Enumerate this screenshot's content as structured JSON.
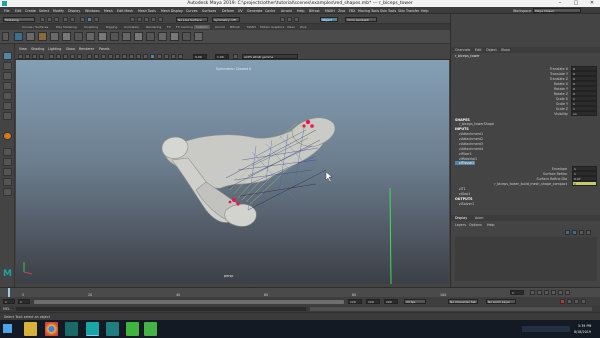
{
  "titlebar": {
    "title": "Autodesk Maya 2019: C:\\projects\\other\\tutorial\\scenes\\examples\\red_shapes.mb*   ---   r_biceps_tower"
  },
  "menubar": {
    "items": [
      "File",
      "Edit",
      "Create",
      "Select",
      "Modify",
      "Display",
      "Windows",
      "Mesh",
      "Edit Mesh",
      "Mesh Tools",
      "Mesh Display",
      "Curves",
      "Surfaces",
      "Deform",
      "UV",
      "Generate",
      "Cache",
      "Arnold",
      "Help",
      "Bifrost",
      "MASH",
      "Ziva",
      "FBX",
      "Moving Tools",
      "Skin Tools",
      "Skin Transfer",
      "Help"
    ],
    "workspace_label": "Workspace:",
    "workspace_value": "Maya Classic"
  },
  "statusline": {
    "mode": "Modeling",
    "no_live": "No Live Surface",
    "symmetry": "Symmetry: Off",
    "object_field": "Object",
    "user": "Chris Garibaldi"
  },
  "shelf": {
    "tabs": [
      "Curves / Surfaces",
      "Poly Modeling",
      "Sculpting",
      "Rigging",
      "Animation",
      "Rendering",
      "FX",
      "FX Caching",
      "Custom",
      "Arnold",
      "Bifrost",
      "MASH",
      "Motion Graphics",
      "XGen",
      "Ziva"
    ]
  },
  "viewport": {
    "menu": [
      "View",
      "Shading",
      "Lighting",
      "Show",
      "Renderer",
      "Panels"
    ],
    "hud_label": "Symmetric: Closest 0",
    "camera_label": "persp",
    "gamma_value": "0.00",
    "exposure_value": "1.00",
    "colorspace": "ACES sRGB gamma"
  },
  "channel_box": {
    "tabs": [
      "Channels",
      "Edit",
      "Object",
      "Show"
    ],
    "object_name": "r_biceps_tower",
    "attributes": [
      {
        "name": "Translate X",
        "value": "0"
      },
      {
        "name": "Translate Y",
        "value": "0"
      },
      {
        "name": "Translate Z",
        "value": "0"
      },
      {
        "name": "Rotate X",
        "value": "0"
      },
      {
        "name": "Rotate Y",
        "value": "0"
      },
      {
        "name": "Rotate Z",
        "value": "0"
      },
      {
        "name": "Scale X",
        "value": "1"
      },
      {
        "name": "Scale Y",
        "value": "1"
      },
      {
        "name": "Scale Z",
        "value": "1"
      },
      {
        "name": "Visibility",
        "value": "on"
      }
    ],
    "shapes_header": "SHAPES",
    "shape_name": "r_biceps_towerShape",
    "inputs_header": "INPUTS",
    "inputs": [
      "ziAttachment1",
      "ziAttachment2",
      "ziAttachment3",
      "ziAttachment4",
      "ziFiber1",
      "ziMaterial1",
      "ziTissue1"
    ],
    "tissue_attrs": [
      {
        "name": "Envelope",
        "value": "1"
      },
      {
        "name": "Surface Refine",
        "value": "1"
      },
      {
        "name": "Surface Refine Dia",
        "value": "0.97"
      },
      {
        "name": "r_biceps_tower_build_mesh_shape_compact",
        "value": "0"
      }
    ],
    "more_inputs": [
      "ziT1",
      "ziGeo1"
    ],
    "outputs_header": "OUTPUTS",
    "outputs": [
      "ziSolver1"
    ]
  },
  "layer_editor": {
    "tabs": [
      "Display",
      "Anim"
    ],
    "menu": [
      "Layers",
      "Options",
      "Help"
    ]
  },
  "timeline": {
    "ticks": [
      "5",
      "10",
      "15",
      "20",
      "25",
      "30",
      "35",
      "40",
      "45",
      "50",
      "55",
      "60",
      "65",
      "70",
      "75",
      "80",
      "85",
      "90",
      "95",
      "100",
      "105",
      "110",
      "115",
      "120"
    ],
    "current_frame": "1"
  },
  "range": {
    "start": "1",
    "start_inner": "1",
    "end_inner": "120",
    "end": "120",
    "end2": "200",
    "fps": "24 fps",
    "character": "No Character Set",
    "anim_layer": "No Anim Layer"
  },
  "cmdline": {
    "label": "MEL"
  },
  "helpline": {
    "text": "Select Tool: select an object"
  },
  "taskbar": {
    "time": "5:39 PM",
    "date": "8/18/2019"
  },
  "colors": {
    "accent": "#5285a6",
    "maya_teal": "#18a7a5",
    "selected_cv": "#e8194b"
  }
}
